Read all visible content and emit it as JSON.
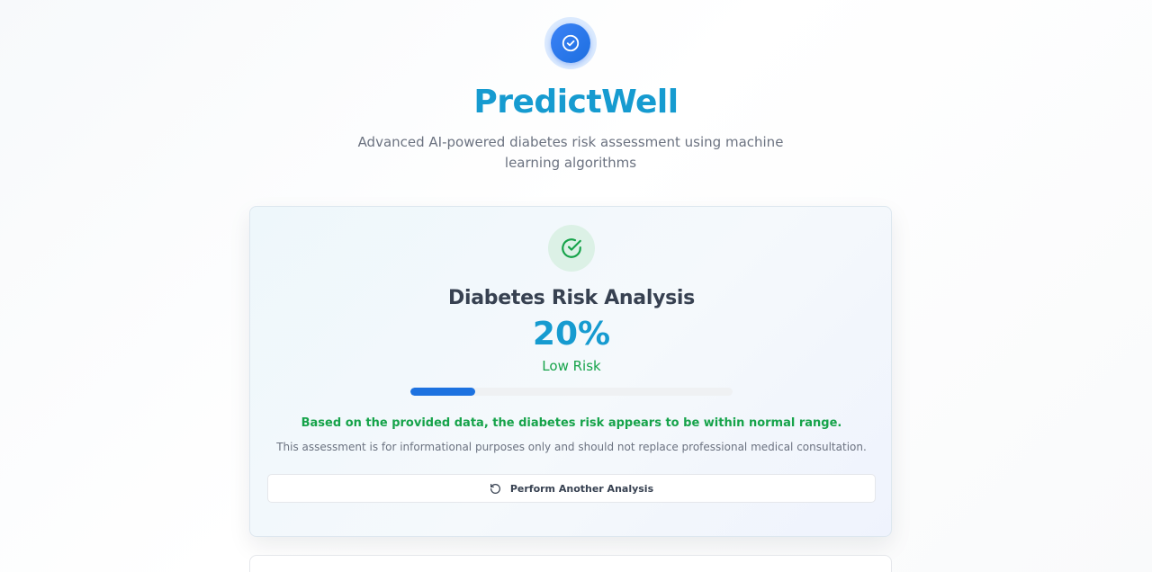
{
  "header": {
    "logo_icon": "check-circle-icon",
    "title": "PredictWell",
    "subtitle": "Advanced AI-powered diabetes risk assessment using machine learning algorithms"
  },
  "result": {
    "status_icon": "check-circle-icon",
    "title": "Diabetes Risk Analysis",
    "percentage": "20%",
    "risk_value": 0.2,
    "level": "Low Risk",
    "message": "Based on the provided data, the diabetes risk appears to be within normal range.",
    "disclaimer": "This assessment is for informational purposes only and should not replace professional medical consultation.",
    "action_label": "Perform Another Analysis",
    "action_icon": "rotate-ccw-icon"
  },
  "colors": {
    "brand": "#169bd0",
    "success": "#16a34a",
    "progress": "#1d72e0"
  }
}
